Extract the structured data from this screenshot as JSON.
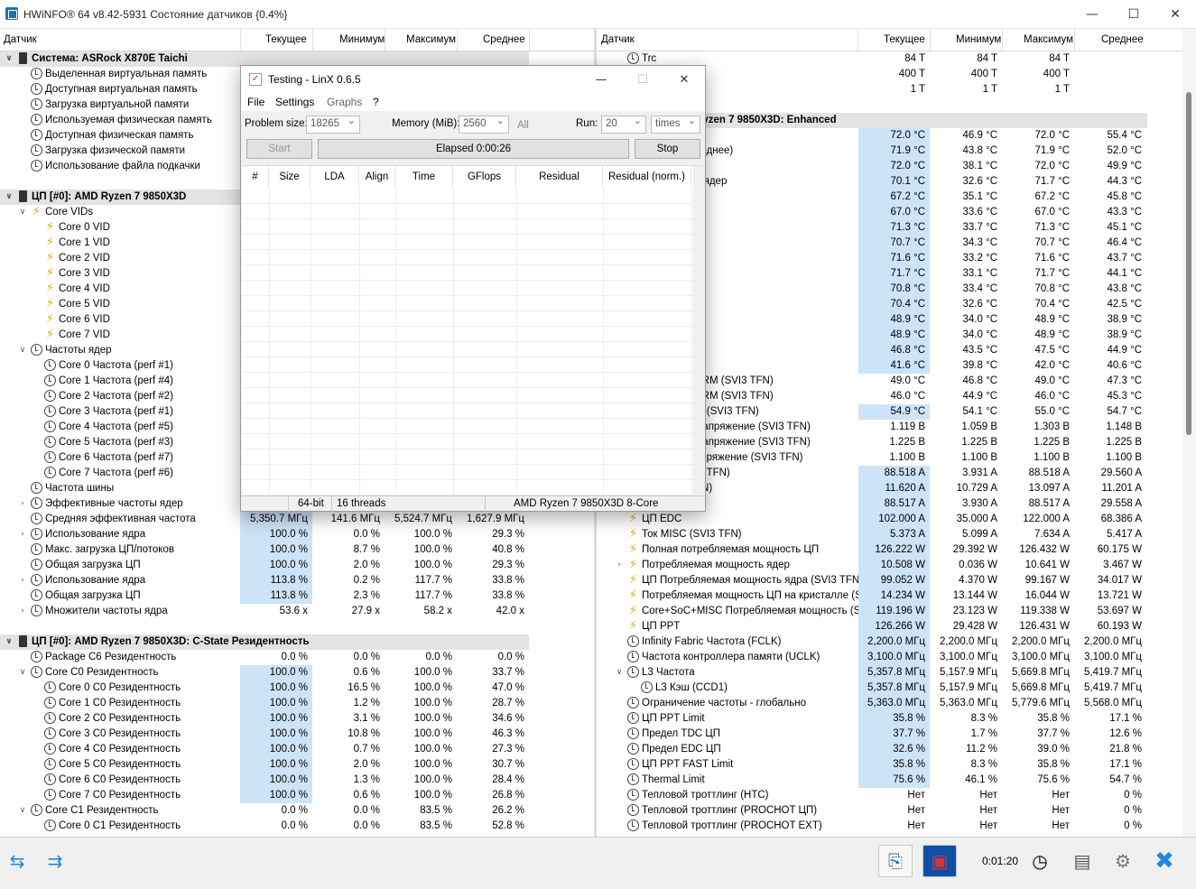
{
  "window": {
    "title": "HWiNFO® 64 v8.42-5931 Состояние датчиков {0.4%}",
    "minimize": "—",
    "maximize": "☐",
    "close": "✕"
  },
  "columns": {
    "sensor": "Датчик",
    "current": "Текущее",
    "min": "Минимум",
    "max": "Максимум",
    "avg": "Среднее"
  },
  "left_rows": [
    {
      "e": "v",
      "ic": "chip",
      "t": "Система: ASRock X870E Taichi",
      "g": 1,
      "ind": 0
    },
    {
      "e": "",
      "ic": "clock",
      "t": "Выделенная виртуальная память",
      "ind": 1
    },
    {
      "e": "",
      "ic": "clock",
      "t": "Доступная виртуальная память",
      "ind": 1
    },
    {
      "e": "",
      "ic": "clock",
      "t": "Загрузка виртуальной памяти",
      "ind": 1
    },
    {
      "e": "",
      "ic": "clock",
      "t": "Используемая физическая память",
      "ind": 1
    },
    {
      "e": "",
      "ic": "clock",
      "t": "Доступная физическая память",
      "ind": 1
    },
    {
      "e": "",
      "ic": "clock",
      "t": "Загрузка физической памяти",
      "ind": 1
    },
    {
      "e": "",
      "ic": "clock",
      "t": "Использование файла подкачки",
      "ind": 1
    },
    {
      "e": "",
      "ic": "none",
      "t": "",
      "ind": 0
    },
    {
      "e": "v",
      "ic": "chip",
      "t": "ЦП [#0]: AMD Ryzen 7 9850X3D",
      "g": 1,
      "ind": 0
    },
    {
      "e": "v",
      "ic": "bolt",
      "t": "Core VIDs",
      "ind": 1
    },
    {
      "e": "",
      "ic": "bolt",
      "t": "Core 0 VID",
      "ind": 2
    },
    {
      "e": "",
      "ic": "bolt",
      "t": "Core 1 VID",
      "ind": 2
    },
    {
      "e": "",
      "ic": "bolt",
      "t": "Core 2 VID",
      "ind": 2
    },
    {
      "e": "",
      "ic": "bolt",
      "t": "Core 3 VID",
      "ind": 2
    },
    {
      "e": "",
      "ic": "bolt",
      "t": "Core 4 VID",
      "ind": 2
    },
    {
      "e": "",
      "ic": "bolt",
      "t": "Core 5 VID",
      "ind": 2
    },
    {
      "e": "",
      "ic": "bolt",
      "t": "Core 6 VID",
      "ind": 2
    },
    {
      "e": "",
      "ic": "bolt",
      "t": "Core 7 VID",
      "ind": 2
    },
    {
      "e": "v",
      "ic": "clock",
      "t": "Частоты ядер",
      "ind": 1
    },
    {
      "e": "",
      "ic": "clock",
      "t": "Core 0 Частота (perf #1)",
      "ind": 2
    },
    {
      "e": "",
      "ic": "clock",
      "t": "Core 1 Частота (perf #4)",
      "ind": 2
    },
    {
      "e": "",
      "ic": "clock",
      "t": "Core 2 Частота (perf #2)",
      "ind": 2
    },
    {
      "e": "",
      "ic": "clock",
      "t": "Core 3 Частота (perf #1)",
      "ind": 2
    },
    {
      "e": "",
      "ic": "clock",
      "t": "Core 4 Частота (perf #5)",
      "ind": 2
    },
    {
      "e": "",
      "ic": "clock",
      "t": "Core 5 Частота (perf #3)",
      "ind": 2
    },
    {
      "e": "",
      "ic": "clock",
      "t": "Core 6 Частота (perf #7)",
      "ind": 2
    },
    {
      "e": "",
      "ic": "clock",
      "t": "Core 7 Частота (perf #6)",
      "ind": 2
    },
    {
      "e": "",
      "ic": "clock",
      "t": "Частота шины",
      "ind": 1
    },
    {
      "e": ">",
      "ic": "clock",
      "t": "Эффективные частоты ядер",
      "ind": 1
    },
    {
      "e": "",
      "ic": "clock",
      "t": "Средняя эффективная частота",
      "ind": 1,
      "c": "5,350.7 МГц",
      "mn": "141.6 МГц",
      "mx": "5,524.7 МГц",
      "a": "1,627.9 МГц"
    },
    {
      "e": ">",
      "ic": "clock",
      "t": "Использование ядра",
      "ind": 1,
      "c": "100.0 %",
      "mn": "0.0 %",
      "mx": "100.0 %",
      "a": "29.3 %"
    },
    {
      "e": "",
      "ic": "clock",
      "t": "Макс. загрузка ЦП/потоков",
      "ind": 1,
      "c": "100.0 %",
      "mn": "8.7 %",
      "mx": "100.0 %",
      "a": "40.8 %"
    },
    {
      "e": "",
      "ic": "clock",
      "t": "Общая загрузка ЦП",
      "ind": 1,
      "c": "100.0 %",
      "mn": "2.0 %",
      "mx": "100.0 %",
      "a": "29.3 %"
    },
    {
      "e": ">",
      "ic": "clock",
      "t": "Использование ядра",
      "ind": 1,
      "c": "113.8 %",
      "mn": "0.2 %",
      "mx": "117.7 %",
      "a": "33.8 %"
    },
    {
      "e": "",
      "ic": "clock",
      "t": "Общая загрузка ЦП",
      "ind": 1,
      "c": "113.8 %",
      "mn": "2.3 %",
      "mx": "117.7 %",
      "a": "33.8 %"
    },
    {
      "e": ">",
      "ic": "clock",
      "t": "Множители частоты ядра",
      "ind": 1,
      "c": "53.6 x",
      "mn": "27.9 x",
      "mx": "58.2 x",
      "a": "42.0 x",
      "nohl": 1
    },
    {
      "e": "",
      "ic": "none",
      "t": "",
      "ind": 0
    },
    {
      "e": "v",
      "ic": "chip",
      "t": "ЦП [#0]: AMD Ryzen 7 9850X3D: C-State Резидентность",
      "g": 1,
      "ind": 0
    },
    {
      "e": "",
      "ic": "clock",
      "t": "Package C6 Резидентность",
      "ind": 1,
      "c": "0.0 %",
      "mn": "0.0 %",
      "mx": "0.0 %",
      "a": "0.0 %",
      "nohl": 1
    },
    {
      "e": "v",
      "ic": "clock",
      "t": "Core C0 Резидентность",
      "ind": 1,
      "c": "100.0 %",
      "mn": "0.6 %",
      "mx": "100.0 %",
      "a": "33.7 %"
    },
    {
      "e": "",
      "ic": "clock",
      "t": "Core 0 C0 Резидентность",
      "ind": 2,
      "c": "100.0 %",
      "mn": "16.5 %",
      "mx": "100.0 %",
      "a": "47.0 %"
    },
    {
      "e": "",
      "ic": "clock",
      "t": "Core 1 C0 Резидентность",
      "ind": 2,
      "c": "100.0 %",
      "mn": "1.2 %",
      "mx": "100.0 %",
      "a": "28.7 %"
    },
    {
      "e": "",
      "ic": "clock",
      "t": "Core 2 C0 Резидентность",
      "ind": 2,
      "c": "100.0 %",
      "mn": "3.1 %",
      "mx": "100.0 %",
      "a": "34.6 %"
    },
    {
      "e": "",
      "ic": "clock",
      "t": "Core 3 C0 Резидентность",
      "ind": 2,
      "c": "100.0 %",
      "mn": "10.8 %",
      "mx": "100.0 %",
      "a": "46.3 %"
    },
    {
      "e": "",
      "ic": "clock",
      "t": "Core 4 C0 Резидентность",
      "ind": 2,
      "c": "100.0 %",
      "mn": "0.7 %",
      "mx": "100.0 %",
      "a": "27.3 %"
    },
    {
      "e": "",
      "ic": "clock",
      "t": "Core 5 C0 Резидентность",
      "ind": 2,
      "c": "100.0 %",
      "mn": "2.0 %",
      "mx": "100.0 %",
      "a": "30.7 %"
    },
    {
      "e": "",
      "ic": "clock",
      "t": "Core 6 C0 Резидентность",
      "ind": 2,
      "c": "100.0 %",
      "mn": "1.3 %",
      "mx": "100.0 %",
      "a": "28.4 %"
    },
    {
      "e": "",
      "ic": "clock",
      "t": "Core 7 C0 Резидентность",
      "ind": 2,
      "c": "100.0 %",
      "mn": "0.6 %",
      "mx": "100.0 %",
      "a": "26.8 %"
    },
    {
      "e": "v",
      "ic": "clock",
      "t": "Core C1 Резидентность",
      "ind": 1,
      "c": "0.0 %",
      "mn": "0.0 %",
      "mx": "83.5 %",
      "a": "26.2 %",
      "nohl": 1
    },
    {
      "e": "",
      "ic": "clock",
      "t": "Core 0 C1 Резидентность",
      "ind": 2,
      "c": "0.0 %",
      "mn": "0.0 %",
      "mx": "83.5 %",
      "a": "52.8 %",
      "nohl": 1
    }
  ],
  "right_rows": [
    {
      "e": "",
      "ic": "clock",
      "t": "Trc",
      "ind": 1,
      "c": "84 T",
      "mn": "84 T",
      "mx": "84 T",
      "a": "",
      "nohl": 1
    },
    {
      "e": "",
      "ic": "none",
      "t": "",
      "ind": 1,
      "c": "400 T",
      "mn": "400 T",
      "mx": "400 T",
      "a": "",
      "nohl": 1
    },
    {
      "e": "",
      "ic": "none",
      "t": "",
      "ind": 1,
      "c": "1 T",
      "mn": "1 T",
      "mx": "1 T",
      "a": "",
      "nohl": 1
    },
    {
      "e": "",
      "ic": "none",
      "t": "",
      "ind": 0
    },
    {
      "e": "",
      "ic": "none",
      "t": "Ryzen 7 9850X3D: Enhanced",
      "g": 1,
      "ind": 6
    },
    {
      "e": "",
      "ic": "none",
      "t": "",
      "ind": 0,
      "c": "72.0 °C",
      "mn": "46.9 °C",
      "mx": "72.0 °C",
      "a": "55.4 °C"
    },
    {
      "e": "",
      "ic": "none",
      "t": "реднее)",
      "ind": 6,
      "c": "71.9 °C",
      "mn": "43.8 °C",
      "mx": "71.9 °C",
      "a": "52.0 °C"
    },
    {
      "e": "",
      "ic": "none",
      "t": "",
      "ind": 0,
      "c": "72.0 °C",
      "mn": "38.1 °C",
      "mx": "72.0 °C",
      "a": "49.9 °C"
    },
    {
      "e": "",
      "ic": "none",
      "t": "и ядер",
      "ind": 6,
      "c": "70.1 °C",
      "mn": "32.6 °C",
      "mx": "71.7 °C",
      "a": "44.3 °C"
    },
    {
      "e": "",
      "ic": "none",
      "t": "",
      "ind": 0,
      "c": "67.2 °C",
      "mn": "35.1 °C",
      "mx": "67.2 °C",
      "a": "45.8 °C"
    },
    {
      "e": "",
      "ic": "none",
      "t": "",
      "ind": 0,
      "c": "67.0 °C",
      "mn": "33.6 °C",
      "mx": "67.0 °C",
      "a": "43.3 °C"
    },
    {
      "e": "",
      "ic": "none",
      "t": "",
      "ind": 0,
      "c": "71.3 °C",
      "mn": "33.7 °C",
      "mx": "71.3 °C",
      "a": "45.1 °C"
    },
    {
      "e": "",
      "ic": "none",
      "t": "",
      "ind": 0,
      "c": "70.7 °C",
      "mn": "34.3 °C",
      "mx": "70.7 °C",
      "a": "46.4 °C"
    },
    {
      "e": "",
      "ic": "none",
      "t": "",
      "ind": 0,
      "c": "71.6 °C",
      "mn": "33.2 °C",
      "mx": "71.6 °C",
      "a": "43.7 °C"
    },
    {
      "e": "",
      "ic": "none",
      "t": "",
      "ind": 0,
      "c": "71.7 °C",
      "mn": "33.1 °C",
      "mx": "71.7 °C",
      "a": "44.1 °C"
    },
    {
      "e": "",
      "ic": "none",
      "t": "",
      "ind": 0,
      "c": "70.8 °C",
      "mn": "33.4 °C",
      "mx": "70.8 °C",
      "a": "43.8 °C"
    },
    {
      "e": "",
      "ic": "none",
      "t": "",
      "ind": 0,
      "c": "70.4 °C",
      "mn": "32.6 °C",
      "mx": "70.4 °C",
      "a": "42.5 °C"
    },
    {
      "e": "",
      "ic": "none",
      "t": "L3",
      "ind": 6,
      "c": "48.9 °C",
      "mn": "34.0 °C",
      "mx": "48.9 °C",
      "a": "38.9 °C"
    },
    {
      "e": "",
      "ic": "none",
      "t": ")",
      "ind": 6,
      "c": "48.9 °C",
      "mn": "34.0 °C",
      "mx": "48.9 °C",
      "a": "38.9 °C"
    },
    {
      "e": "",
      "ic": "none",
      "t": "",
      "ind": 0,
      "c": "46.8 °C",
      "mn": "43.5 °C",
      "mx": "47.5 °C",
      "a": "44.9 °C"
    },
    {
      "e": "",
      "ic": "none",
      "t": ")",
      "ind": 6,
      "c": "41.6 °C",
      "mn": "39.8 °C",
      "mx": "42.0 °C",
      "a": "40.6 °C"
    },
    {
      "e": "",
      "ic": "none",
      "t": "VRM (SVI3 TFN)",
      "ind": 6,
      "c": "49.0 °C",
      "mn": "46.8 °C",
      "mx": "49.0 °C",
      "a": "47.3 °C",
      "nohl": 1
    },
    {
      "e": "",
      "ic": "none",
      "t": "VRM (SVI3 TFN)",
      "ind": 6,
      "c": "46.0 °C",
      "mn": "44.9 °C",
      "mx": "46.0 °C",
      "a": "45.3 °C",
      "nohl": 1
    },
    {
      "e": "",
      "ic": "none",
      "t": "M (SVI3 TFN)",
      "ind": 6,
      "c": "54.9 °C",
      "mn": "54.1 °C",
      "mx": "55.0 °C",
      "a": "54.7 °C"
    },
    {
      "e": "",
      "ic": "none",
      "t": "Напряжение (SVI3 TFN)",
      "ind": 6,
      "c": "1.119 В",
      "mn": "1.059 В",
      "mx": "1.303 В",
      "a": "1.148 В",
      "nohl": 1
    },
    {
      "e": "",
      "ic": "none",
      "t": "Напряжение (SVI3 TFN)",
      "ind": 6,
      "c": "1.225 В",
      "mn": "1.225 В",
      "mx": "1.225 В",
      "a": "1.225 В",
      "nohl": 1
    },
    {
      "e": "",
      "ic": "none",
      "t": "апряжение (SVI3 TFN)",
      "ind": 6,
      "c": "1.100 В",
      "mn": "1.100 В",
      "mx": "1.100 В",
      "a": "1.100 В",
      "nohl": 1
    },
    {
      "e": "",
      "ic": "none",
      "t": "I3 TFN)",
      "ind": 6,
      "c": "88.518 A",
      "mn": "3.931 A",
      "mx": "88.518 A",
      "a": "29.560 A"
    },
    {
      "e": "",
      "ic": "none",
      "t": "FN)",
      "ind": 6,
      "c": "11.620 A",
      "mn": "10.729 A",
      "mx": "13.097 A",
      "a": "11.201 A"
    },
    {
      "e": "",
      "ic": "none",
      "t": "",
      "ind": 0,
      "c": "88.517 A",
      "mn": "3.930 A",
      "mx": "88.517 A",
      "a": "29.558 A"
    },
    {
      "e": "",
      "ic": "bolt",
      "t": "ЦП EDC",
      "ind": 1,
      "c": "102.000 A",
      "mn": "35.000 A",
      "mx": "122.000 A",
      "a": "68.386 A"
    },
    {
      "e": "",
      "ic": "bolt",
      "t": "Ток MISC (SVI3 TFN)",
      "ind": 1,
      "c": "5.373 A",
      "mn": "5.099 A",
      "mx": "7.634 A",
      "a": "5.417 A"
    },
    {
      "e": "",
      "ic": "bolt",
      "t": "Полная потребляемая мощность ЦП",
      "ind": 1,
      "c": "126.222 W",
      "mn": "29.392 W",
      "mx": "126.432 W",
      "a": "60.175 W"
    },
    {
      "e": ">",
      "ic": "bolt",
      "t": "Потребляемая мощность ядер",
      "ind": 1,
      "c": "10.508 W",
      "mn": "0.036 W",
      "mx": "10.641 W",
      "a": "3.467 W"
    },
    {
      "e": "",
      "ic": "bolt",
      "t": "ЦП Потребляемая мощность ядра (SVI3 TFN)",
      "ind": 1,
      "c": "99.052 W",
      "mn": "4.370 W",
      "mx": "99.167 W",
      "a": "34.017 W"
    },
    {
      "e": "",
      "ic": "bolt",
      "t": "Потребляемая мощность ЦП на кристалле (SV...",
      "ind": 1,
      "c": "14.234 W",
      "mn": "13.144 W",
      "mx": "16.044 W",
      "a": "13.721 W"
    },
    {
      "e": "",
      "ic": "bolt",
      "t": "Core+SoC+MISC Потребляемая мощность (SVI...",
      "ind": 1,
      "c": "119.196 W",
      "mn": "23.123 W",
      "mx": "119.338 W",
      "a": "53.697 W"
    },
    {
      "e": "",
      "ic": "bolt",
      "t": "ЦП PPT",
      "ind": 1,
      "c": "126.266 W",
      "mn": "29.428 W",
      "mx": "126.431 W",
      "a": "60.193 W"
    },
    {
      "e": "",
      "ic": "clock",
      "t": "Infinity Fabric Частота (FCLK)",
      "ind": 1,
      "c": "2,200.0 МГц",
      "mn": "2,200.0 МГц",
      "mx": "2,200.0 МГц",
      "a": "2,200.0 МГц"
    },
    {
      "e": "",
      "ic": "clock",
      "t": "Частота контроллера памяти (UCLK)",
      "ind": 1,
      "c": "3,100.0 МГц",
      "mn": "3,100.0 МГц",
      "mx": "3,100.0 МГц",
      "a": "3,100.0 МГц"
    },
    {
      "e": "v",
      "ic": "clock",
      "t": "L3 Частота",
      "ind": 1,
      "c": "5,357.8 МГц",
      "mn": "5,157.9 МГц",
      "mx": "5,669.8 МГц",
      "a": "5,419.7 МГц"
    },
    {
      "e": "",
      "ic": "clock",
      "t": "L3 Кэш (CCD1)",
      "ind": 2,
      "c": "5,357.8 МГц",
      "mn": "5,157.9 МГц",
      "mx": "5,669.8 МГц",
      "a": "5,419.7 МГц"
    },
    {
      "e": "",
      "ic": "clock",
      "t": "Ограничение частоты - глобально",
      "ind": 1,
      "c": "5,363.0 МГц",
      "mn": "5,363.0 МГц",
      "mx": "5,779.6 МГц",
      "a": "5,568.0 МГц"
    },
    {
      "e": "",
      "ic": "clock",
      "t": "ЦП PPT Limit",
      "ind": 1,
      "c": "35.8 %",
      "mn": "8.3 %",
      "mx": "35.8 %",
      "a": "17.1 %"
    },
    {
      "e": "",
      "ic": "clock",
      "t": "Предел TDC ЦП",
      "ind": 1,
      "c": "37.7 %",
      "mn": "1.7 %",
      "mx": "37.7 %",
      "a": "12.6 %"
    },
    {
      "e": "",
      "ic": "clock",
      "t": "Предел EDC ЦП",
      "ind": 1,
      "c": "32.6 %",
      "mn": "11.2 %",
      "mx": "39.0 %",
      "a": "21.8 %"
    },
    {
      "e": "",
      "ic": "clock",
      "t": "ЦП PPT FAST Limit",
      "ind": 1,
      "c": "35.8 %",
      "mn": "8.3 %",
      "mx": "35.8 %",
      "a": "17.1 %"
    },
    {
      "e": "",
      "ic": "clock",
      "t": "Thermal Limit",
      "ind": 1,
      "c": "75.6 %",
      "mn": "46.1 %",
      "mx": "75.6 %",
      "a": "54.7 %"
    },
    {
      "e": "",
      "ic": "clock",
      "t": "Тепловой троттлинг (HTC)",
      "ind": 1,
      "c": "Нет",
      "mn": "Нет",
      "mx": "Нет",
      "a": "0 %",
      "nohl": 1
    },
    {
      "e": "",
      "ic": "clock",
      "t": "Тепловой троттлинг (PROCHOT ЦП)",
      "ind": 1,
      "c": "Нет",
      "mn": "Нет",
      "mx": "Нет",
      "a": "0 %",
      "nohl": 1
    },
    {
      "e": "",
      "ic": "clock",
      "t": "Тепловой троттлинг (PROCHOT EXT)",
      "ind": 1,
      "c": "Нет",
      "mn": "Нет",
      "mx": "Нет",
      "a": "0 %",
      "nohl": 1
    }
  ],
  "linx": {
    "title": "Testing - LinX 0.6.5",
    "menu": [
      "File",
      "Settings",
      "Graphs",
      "?"
    ],
    "problem_size_label": "Problem size:",
    "problem_size": "18265",
    "memory_label": "Memory (MiB):",
    "memory": "2560",
    "all_label": "All",
    "run_label": "Run:",
    "run": "20",
    "run_unit": "times",
    "start_label": "Start",
    "elapsed": "Elapsed 0:00:26",
    "stop_label": "Stop",
    "columns": [
      "#",
      "Size",
      "LDA",
      "Align",
      "Time",
      "GFlops",
      "Residual",
      "Residual (norm.)"
    ],
    "status": {
      "bits": "64-bit",
      "threads": "16 threads",
      "cpu": "AMD Ryzen 7 9850X3D 8-Core"
    }
  },
  "bottom": {
    "timer": "0:01:20"
  },
  "colors": {
    "highlight": "#cde3f7",
    "group_bg": "#e3e3e3",
    "bolt": "#e8a800",
    "close_x": "#1e88e5"
  }
}
